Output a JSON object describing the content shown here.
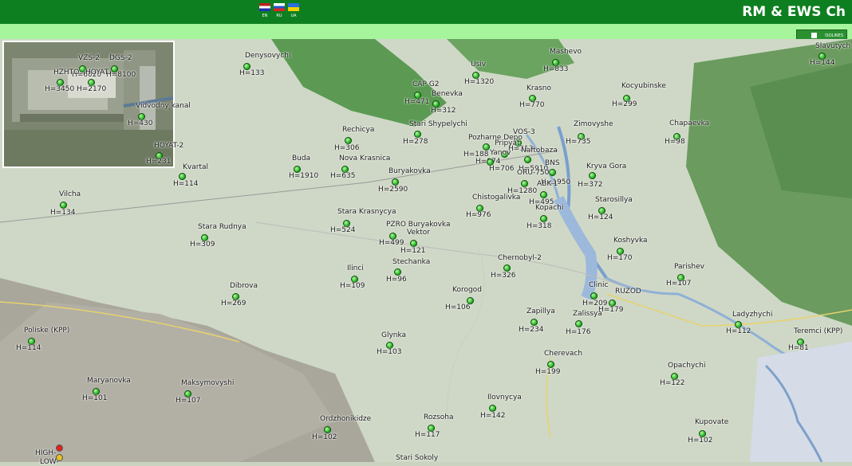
{
  "header": {
    "title": "RM & EWS Ch",
    "flags": [
      {
        "code": "EN",
        "label": "EN"
      },
      {
        "code": "RU",
        "label": "RU"
      },
      {
        "code": "UA",
        "label": "UA"
      }
    ]
  },
  "toolbar": {
    "isolines_label": "ISOLINES"
  },
  "colors": {
    "header_bg": "#0e7f20",
    "subbar_bg": "#a6f59c",
    "marker": "#2fbf2c",
    "high": "#e02020",
    "low": "#e8c020"
  },
  "legend": {
    "high_label": "HIGH-",
    "low_label": "LOW-"
  },
  "inset_stations": [
    {
      "name": "VZS-2",
      "value": "H=6020"
    },
    {
      "name": "DGS-2",
      "value": "H=8100"
    },
    {
      "name": "HZHTO",
      "value": "H=3450"
    },
    {
      "name": "HOYAT",
      "value": "H=2170"
    },
    {
      "name": "Vidvodny kanal",
      "value": "H=430"
    },
    {
      "name": "HOYAT-2",
      "value": "H=231"
    }
  ],
  "stations": [
    {
      "name": "Denysovychi",
      "value": "H=133"
    },
    {
      "name": "Usiv",
      "value": "H=1320"
    },
    {
      "name": "Mashevo",
      "value": "H=833"
    },
    {
      "name": "Slavutych",
      "value": "H=144"
    },
    {
      "name": "CAP G2",
      "value": "H=471"
    },
    {
      "name": "Benevka",
      "value": "H=312"
    },
    {
      "name": "Krasno",
      "value": "H=770"
    },
    {
      "name": "Kocyubinske",
      "value": "H=299"
    },
    {
      "name": "Stari Shypelychi",
      "value": "H=278"
    },
    {
      "name": "Rechicya",
      "value": "H=306"
    },
    {
      "name": "Zimovyshe",
      "value": "H=735"
    },
    {
      "name": "Chapaevka",
      "value": "H=98"
    },
    {
      "name": "VOS-3",
      "value": "H=313"
    },
    {
      "name": "Pozharne Depo",
      "value": "H=188"
    },
    {
      "name": "Pripyat",
      "value": "H=974"
    },
    {
      "name": "Yanov",
      "value": "H=706"
    },
    {
      "name": "Naftobaza",
      "value": "H=5910"
    },
    {
      "name": "BNS",
      "value": "H=1950"
    },
    {
      "name": "ORU-750",
      "value": "H=1280"
    },
    {
      "name": "ABK-1",
      "value": "H=495"
    },
    {
      "name": "Buda",
      "value": "H=1910"
    },
    {
      "name": "Nova Krasnica",
      "value": "H=635"
    },
    {
      "name": "Buryakovka",
      "value": "H=2590"
    },
    {
      "name": "Kvartal",
      "value": "H=114"
    },
    {
      "name": "Kryva Gora",
      "value": "H=372"
    },
    {
      "name": "Vilcha",
      "value": "H=134"
    },
    {
      "name": "Chistogalivka",
      "value": "H=976"
    },
    {
      "name": "Kopachi",
      "value": "H=318"
    },
    {
      "name": "Starosillya",
      "value": "H=124"
    },
    {
      "name": "Stara Krasnycya",
      "value": "H=524"
    },
    {
      "name": "Stara Rudnya",
      "value": "H=309"
    },
    {
      "name": "PZRO Buryakovka",
      "value": "H=499"
    },
    {
      "name": "Vektor",
      "value": "H=121"
    },
    {
      "name": "Koshyvka",
      "value": "H=170"
    },
    {
      "name": "Stechanka",
      "value": "H=96"
    },
    {
      "name": "Chernobyl-2",
      "value": "H=326"
    },
    {
      "name": "Ilinci",
      "value": "H=109"
    },
    {
      "name": "Parishev",
      "value": "H=107"
    },
    {
      "name": "Dibrova",
      "value": "H=269"
    },
    {
      "name": "Clinic",
      "value": "H=209"
    },
    {
      "name": "RUZOD",
      "value": "H=179"
    },
    {
      "name": "Korogod",
      "value": "H=106"
    },
    {
      "name": "Zapillya",
      "value": "H=234"
    },
    {
      "name": "Zalissya",
      "value": "H=176"
    },
    {
      "name": "Ladyzhychi",
      "value": "H=112"
    },
    {
      "name": "Teremci (KPP)",
      "value": "H=81"
    },
    {
      "name": "Poliske (KPP)",
      "value": "H=114"
    },
    {
      "name": "Glynka",
      "value": "H=103"
    },
    {
      "name": "Cherevach",
      "value": "H=199"
    },
    {
      "name": "Opachychi",
      "value": "H=122"
    },
    {
      "name": "Maryanovka",
      "value": "H=101"
    },
    {
      "name": "Maksymovyshi",
      "value": "H=107"
    },
    {
      "name": "Ilovnycya",
      "value": "H=142"
    },
    {
      "name": "Ordzhonikidze",
      "value": "H=102"
    },
    {
      "name": "Rozsoha",
      "value": "H=117"
    },
    {
      "name": "Kupovate",
      "value": "H=102"
    },
    {
      "name": "Stari Sokoly",
      "value": ""
    }
  ]
}
